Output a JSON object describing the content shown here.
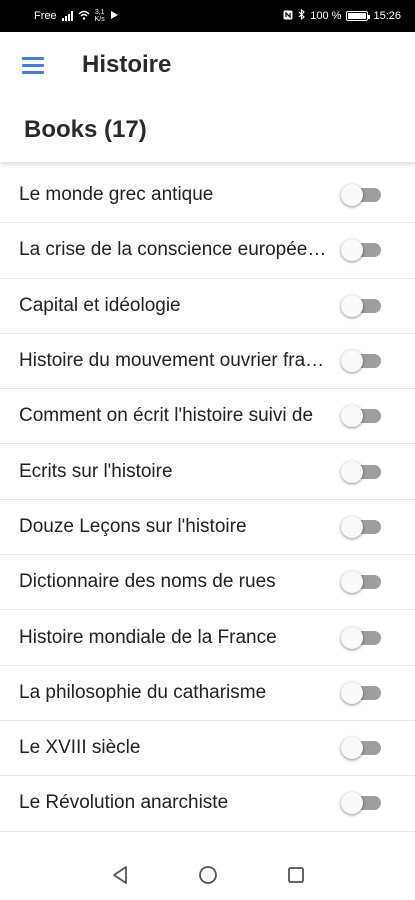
{
  "status_bar": {
    "carrier": "Free",
    "speed": "3,1\nK/s",
    "battery_percent": "100 %",
    "time": "15:26"
  },
  "app_bar": {
    "title": "Histoire",
    "menu_icon": "hamburger-menu-icon"
  },
  "section": {
    "header": "Books (17)"
  },
  "books": [
    {
      "title": "Le monde grec antique",
      "enabled": false
    },
    {
      "title": "La crise de la conscience européenne",
      "enabled": false
    },
    {
      "title": "Capital et idéologie",
      "enabled": false
    },
    {
      "title": "Histoire du mouvement ouvrier français",
      "enabled": false
    },
    {
      "title": "Comment on écrit l'histoire suivi de",
      "enabled": false
    },
    {
      "title": "Ecrits sur l'histoire",
      "enabled": false
    },
    {
      "title": "Douze Leçons sur l'histoire",
      "enabled": false
    },
    {
      "title": "Dictionnaire des noms de rues",
      "enabled": false
    },
    {
      "title": "Histoire mondiale de la France",
      "enabled": false
    },
    {
      "title": "La philosophie du catharisme",
      "enabled": false
    },
    {
      "title": "Le XVIII siècle",
      "enabled": false
    },
    {
      "title": "Le Révolution anarchiste",
      "enabled": false
    }
  ],
  "colors": {
    "accent": "#4a7fd4",
    "toggle_track_off": "#9e9e9e",
    "toggle_thumb_off": "#fafafa"
  },
  "nav_bar": {
    "icons": [
      "back-icon",
      "home-icon",
      "recents-icon"
    ]
  }
}
